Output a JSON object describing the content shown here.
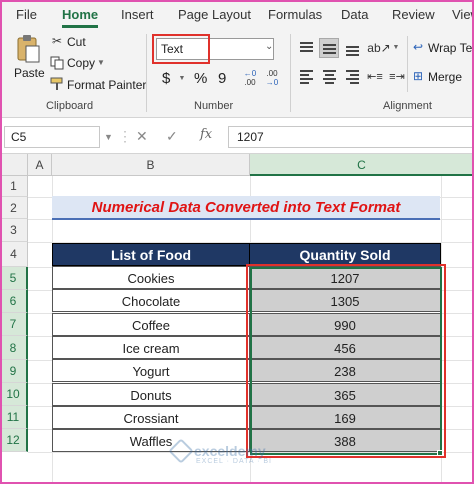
{
  "ribbon_tabs": [
    "File",
    "Home",
    "Insert",
    "Page Layout",
    "Formulas",
    "Data",
    "Review",
    "View"
  ],
  "clipboard": {
    "paste_label": "Paste",
    "cut_label": "Cut",
    "copy_label": "Copy",
    "format_painter_label": "Format Painter",
    "group_label": "Clipboard"
  },
  "number": {
    "format_value": "Text",
    "currency_symbol": "$",
    "percent_symbol": "%",
    "comma_symbol": "9",
    "group_label": "Number"
  },
  "alignment": {
    "wrap_text_label": "Wrap Te",
    "merge_label": "Merge",
    "group_label": "Alignment"
  },
  "formula_bar": {
    "name_box": "C5",
    "fx_label": "fx",
    "content": "1207"
  },
  "columns": [
    "A",
    "B",
    "C"
  ],
  "rows": [
    "1",
    "2",
    "3",
    "4",
    "5",
    "6",
    "7",
    "8",
    "9",
    "10",
    "11",
    "12"
  ],
  "sheet": {
    "title": "Numerical Data Converted into Text Format",
    "headers": [
      "List of Food",
      "Quantity Sold"
    ],
    "records": [
      {
        "food": "Cookies",
        "qty": "1207"
      },
      {
        "food": "Chocolate",
        "qty": "1305"
      },
      {
        "food": "Coffee",
        "qty": "990"
      },
      {
        "food": "Ice cream",
        "qty": "456"
      },
      {
        "food": "Yogurt",
        "qty": "238"
      },
      {
        "food": "Donuts",
        "qty": "365"
      },
      {
        "food": "Crossiant",
        "qty": "169"
      },
      {
        "food": "Waffles",
        "qty": "388"
      }
    ]
  },
  "watermark": {
    "name": "exceldemy",
    "tagline": "EXCEL · DATA · BI"
  },
  "colors": {
    "accent_green": "#217346",
    "header_navy": "#1f3864",
    "highlight_red": "#e0312b",
    "title_red": "#e01414"
  }
}
